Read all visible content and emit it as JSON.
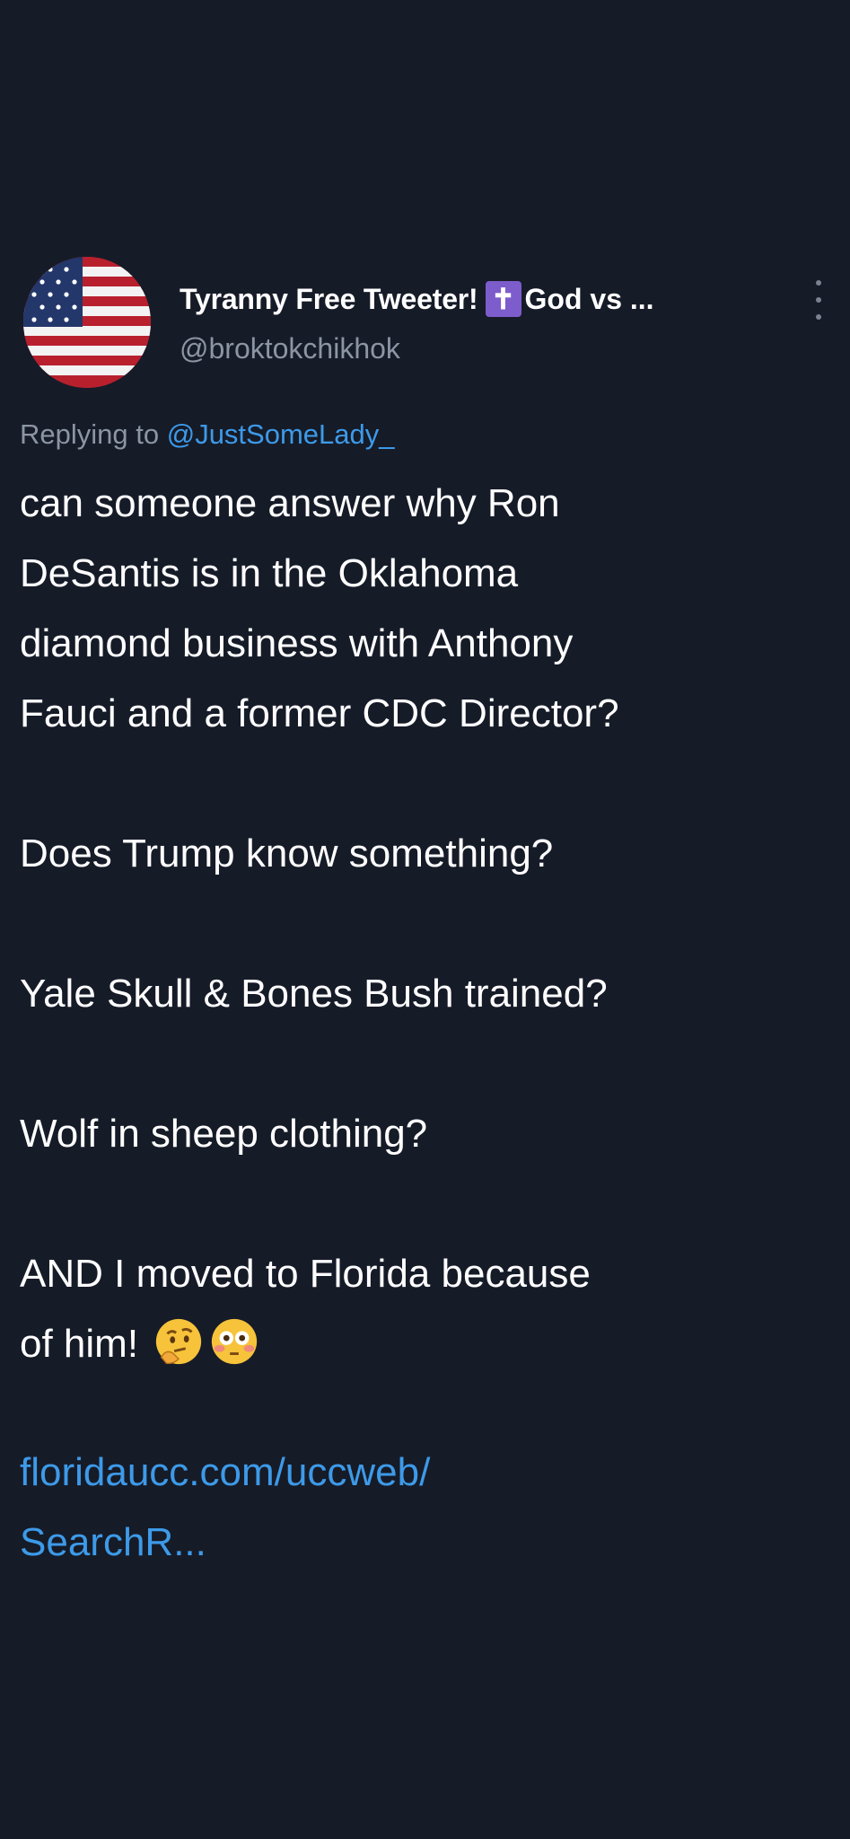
{
  "tweet": {
    "display_name": "Tyranny Free Tweeter!",
    "badge_symbol": "✝",
    "display_name_suffix": "God vs ...",
    "handle": "@broktokchikhok",
    "replying_prefix": "Replying to",
    "replying_mention": "@JustSomeLady_",
    "avatar_icon": "us-flag",
    "menu_icon": "vertical-ellipsis",
    "body": {
      "line1": "can someone answer why Ron",
      "line2": "DeSantis is in the Oklahoma",
      "line3": "diamond business with Anthony",
      "line4": "Fauci and a former CDC Director?",
      "line5": "Does Trump know something?",
      "line6": "Yale Skull & Bones Bush trained?",
      "line7": "Wolf in sheep clothing?",
      "line8": "AND I moved to Florida because",
      "line9": "of him!"
    },
    "emojis": [
      "thinking-face-emoji",
      "flushed-face-emoji"
    ],
    "link_line1": "floridaucc.com/uccweb/",
    "link_line2": "SearchR..."
  },
  "colors": {
    "background": "#161b28",
    "text": "#ffffff",
    "secondary": "#8b95a3",
    "link": "#3d9ae8",
    "badge": "#7d5ccb"
  }
}
